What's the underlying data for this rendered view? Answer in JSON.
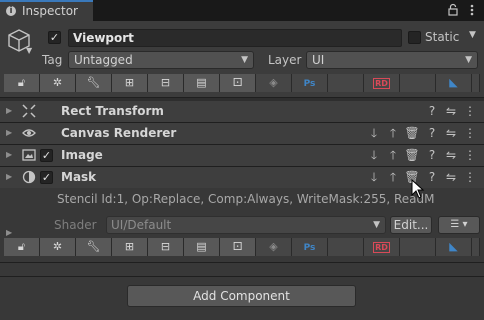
{
  "window": {
    "tab_title": "Inspector"
  },
  "header": {
    "name": "Viewport",
    "static_label": "Static",
    "tag_label": "Tag",
    "tag_value": "Untagged",
    "layer_label": "Layer",
    "layer_value": "UI",
    "active_checkmark": "✓"
  },
  "toolbar": {
    "ps_label": "Ps",
    "rd_label": "RD"
  },
  "components": [
    {
      "title": "Rect Transform",
      "icon": "rect-transform-icon"
    },
    {
      "title": "Canvas Renderer",
      "icon": "eye-icon"
    },
    {
      "title": "Image",
      "icon": "image-icon",
      "checkmark": "✓"
    },
    {
      "title": "Mask",
      "icon": "mask-icon",
      "checkmark": "✓"
    }
  ],
  "material": {
    "stencil_text": "Stencil Id:1, Op:Replace, Comp:Always, WriteMask:255, ReadM",
    "shader_label": "Shader",
    "shader_value": "UI/Default",
    "edit_label": "Edit...",
    "list_label": "☰ ▾"
  },
  "add_component_label": "Add Component",
  "colors": {
    "accent": "#3a79bb",
    "background": "#383838",
    "panel": "#3c3c3c"
  }
}
